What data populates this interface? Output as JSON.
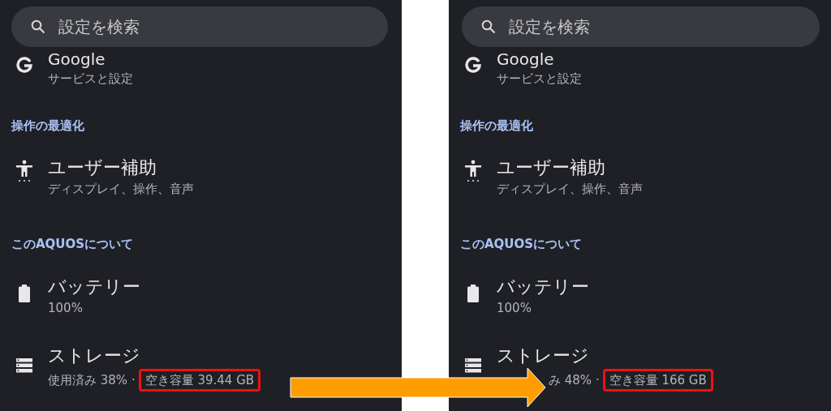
{
  "panels": [
    {
      "search": {
        "placeholder": "設定を検索"
      },
      "items": [
        {
          "kind": "google",
          "title": "Google",
          "subtitle": "サービスと設定"
        },
        {
          "kind": "header",
          "title": "操作の最適化"
        },
        {
          "kind": "accessibility",
          "title": "ユーザー補助",
          "subtitle": "ディスプレイ、操作、音声"
        },
        {
          "kind": "header",
          "title": "このAQUOSについて"
        },
        {
          "kind": "battery",
          "title": "バッテリー",
          "subtitle": "100%"
        },
        {
          "kind": "storage",
          "title": "ストレージ",
          "subtitle": "使用済み 38% ·",
          "highlight": "空き容量 39.44 GB"
        }
      ]
    },
    {
      "search": {
        "placeholder": "設定を検索"
      },
      "items": [
        {
          "kind": "google",
          "title": "Google",
          "subtitle": "サービスと設定"
        },
        {
          "kind": "header",
          "title": "操作の最適化"
        },
        {
          "kind": "accessibility",
          "title": "ユーザー補助",
          "subtitle": "ディスプレイ、操作、音声"
        },
        {
          "kind": "header",
          "title": "このAQUOSについて"
        },
        {
          "kind": "battery",
          "title": "バッテリー",
          "subtitle": "100%"
        },
        {
          "kind": "storage",
          "title": "ストレージ",
          "subtitle": "み 48% ·",
          "highlight": "空き容量 166 GB"
        }
      ]
    }
  ],
  "annotation": {
    "arrow": true
  }
}
